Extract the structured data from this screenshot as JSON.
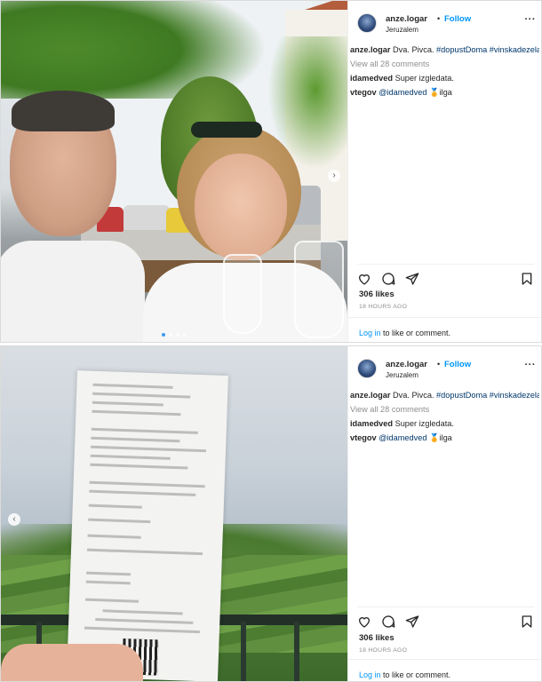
{
  "posts": [
    {
      "username": "anze.logar",
      "separator": "•",
      "follow_label": "Follow",
      "location": "Jeruzalem",
      "more_label": "···",
      "caption": {
        "user": "anze.logar",
        "text": "Dva. Pivca.",
        "hashtags": "#dopustDoma #vinskadezela"
      },
      "view_all": "View all 28 comments",
      "comments": [
        {
          "user": "idamedved",
          "text": "Super izgledata."
        },
        {
          "user": "vtegov",
          "mention": "@idamedved",
          "emoji": "🏅",
          "text": "ilga"
        }
      ],
      "likes": "306 likes",
      "time": "18 HOURS AGO",
      "login": {
        "link": "Log in",
        "rest": " to like or comment."
      },
      "icons": {
        "like": "heart-icon",
        "comment": "comment-icon",
        "share": "share-icon",
        "save": "bookmark-icon"
      }
    },
    {
      "username": "anze.logar",
      "separator": "•",
      "follow_label": "Follow",
      "location": "Jeruzalem",
      "more_label": "···",
      "caption": {
        "user": "anze.logar",
        "text": "Dva. Pivca.",
        "hashtags": "#dopustDoma #vinskadezela"
      },
      "view_all": "View all 28 comments",
      "comments": [
        {
          "user": "idamedved",
          "text": "Super izgledata."
        },
        {
          "user": "vtegov",
          "mention": "@idamedved",
          "emoji": "🏅",
          "text": "ilga"
        }
      ],
      "likes": "306 likes",
      "time": "18 HOURS AGO",
      "login": {
        "link": "Log in",
        "rest": " to like or comment."
      },
      "icons": {
        "like": "heart-icon",
        "comment": "comment-icon",
        "share": "share-icon",
        "save": "bookmark-icon"
      }
    }
  ],
  "colors": {
    "link_blue": "#0095f6",
    "hashtag": "#00376b",
    "muted": "#8e8e8e",
    "text": "#262626",
    "border": "#dbdbdb"
  }
}
